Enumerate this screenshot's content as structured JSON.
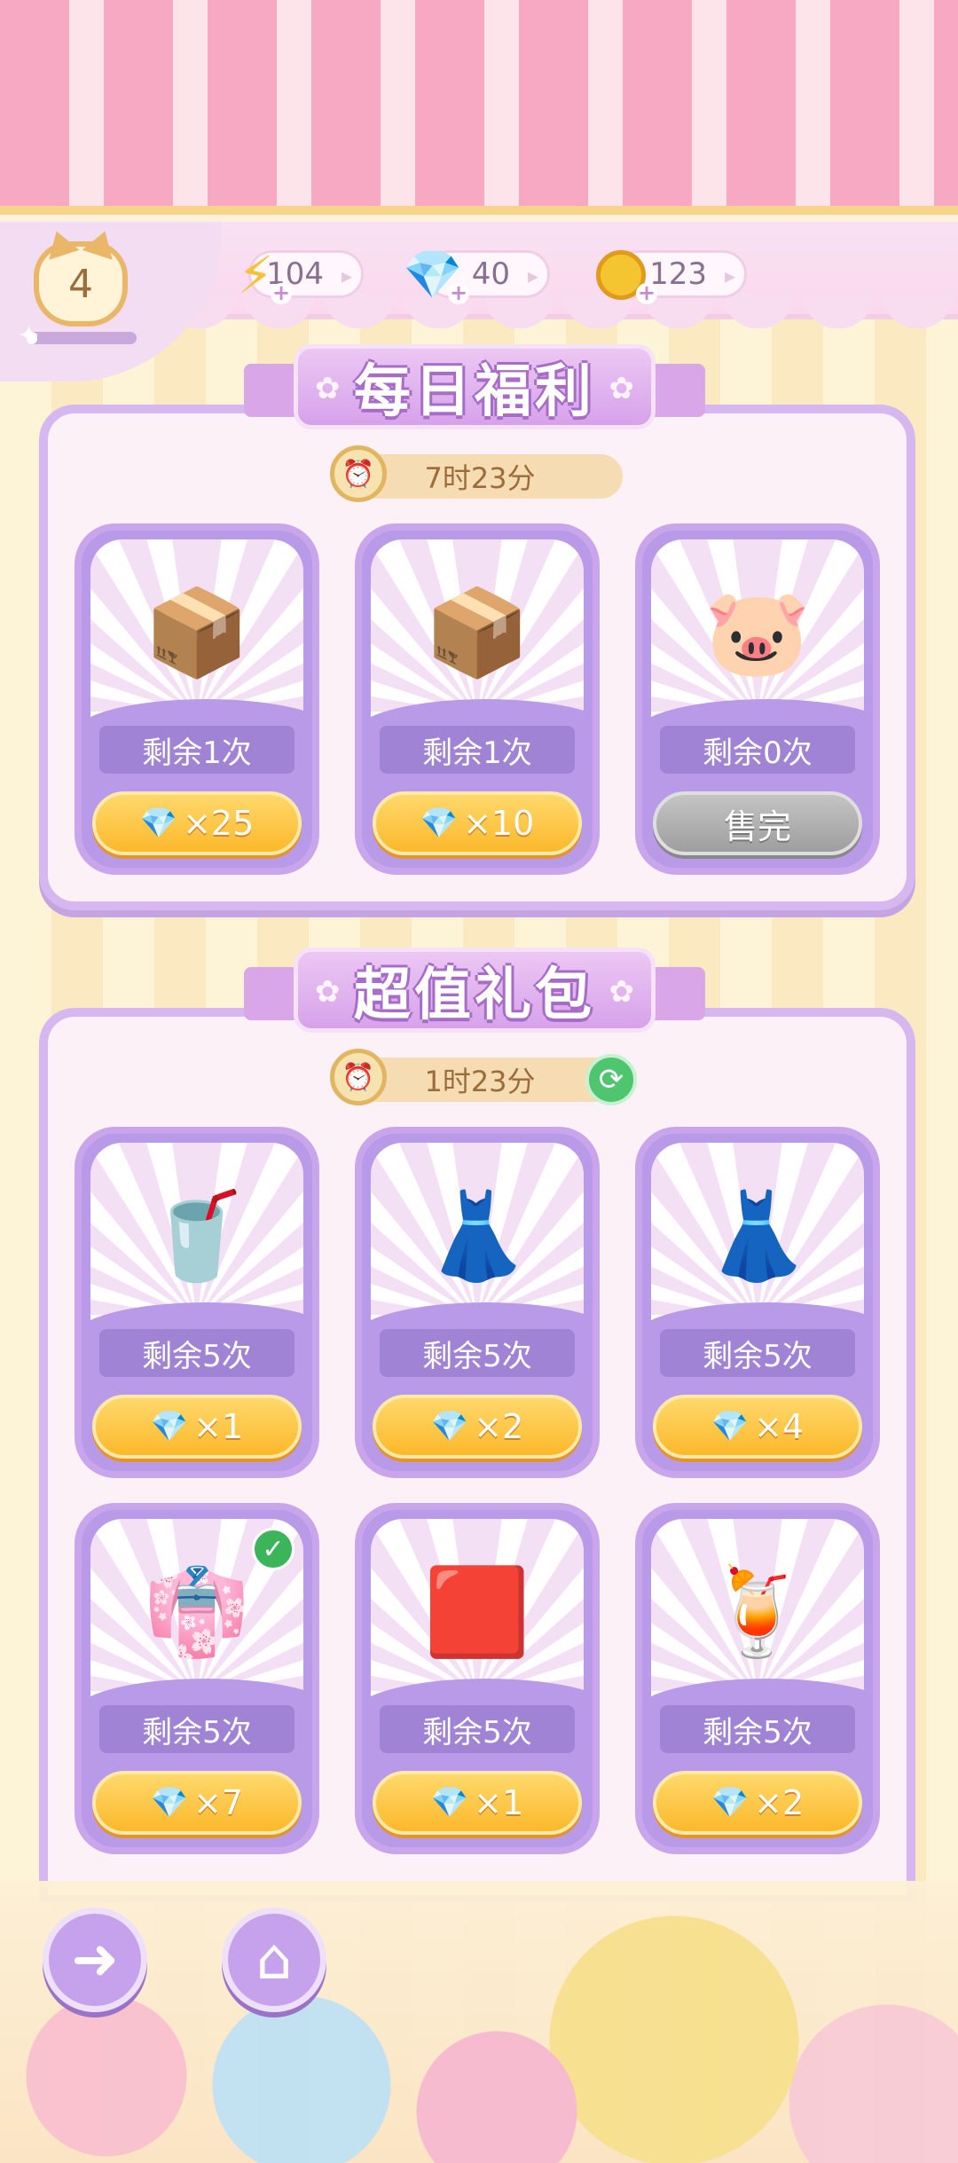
{
  "header": {
    "level": "4",
    "xp_progress": 0.1,
    "energy": "104",
    "gems": "40",
    "coins": "123"
  },
  "daily": {
    "title": "每日福利",
    "timer": "7时23分",
    "items": [
      {
        "icon": "cat-box-coin",
        "emoji": "📦",
        "remaining": "剩余1次",
        "price": "×25",
        "sold_out": false
      },
      {
        "icon": "cat-box-energy",
        "emoji": "📦",
        "remaining": "剩余1次",
        "price": "×10",
        "sold_out": false
      },
      {
        "icon": "piggy-bank",
        "emoji": "🐷",
        "remaining": "剩余0次",
        "price": "售完",
        "sold_out": true
      }
    ]
  },
  "bundle": {
    "title": "超值礼包",
    "timer": "1时23分",
    "items": [
      {
        "icon": "iced-tea",
        "emoji": "🥤",
        "remaining": "剩余5次",
        "price": "×1"
      },
      {
        "icon": "gray-dress",
        "emoji": "👗",
        "remaining": "剩余5次",
        "price": "×2"
      },
      {
        "icon": "gold-dress",
        "emoji": "👗",
        "remaining": "剩余5次",
        "price": "×4"
      },
      {
        "icon": "pink-dress",
        "emoji": "👘",
        "remaining": "剩余5次",
        "price": "×7",
        "owned": true
      },
      {
        "icon": "pink-cushion",
        "emoji": "🟥",
        "remaining": "剩余5次",
        "price": "×1"
      },
      {
        "icon": "lemon-drink",
        "emoji": "🍹",
        "remaining": "剩余5次",
        "price": "×2"
      }
    ]
  },
  "nav": {
    "back_icon": "back-arrow-icon",
    "home_icon": "home-icon"
  }
}
